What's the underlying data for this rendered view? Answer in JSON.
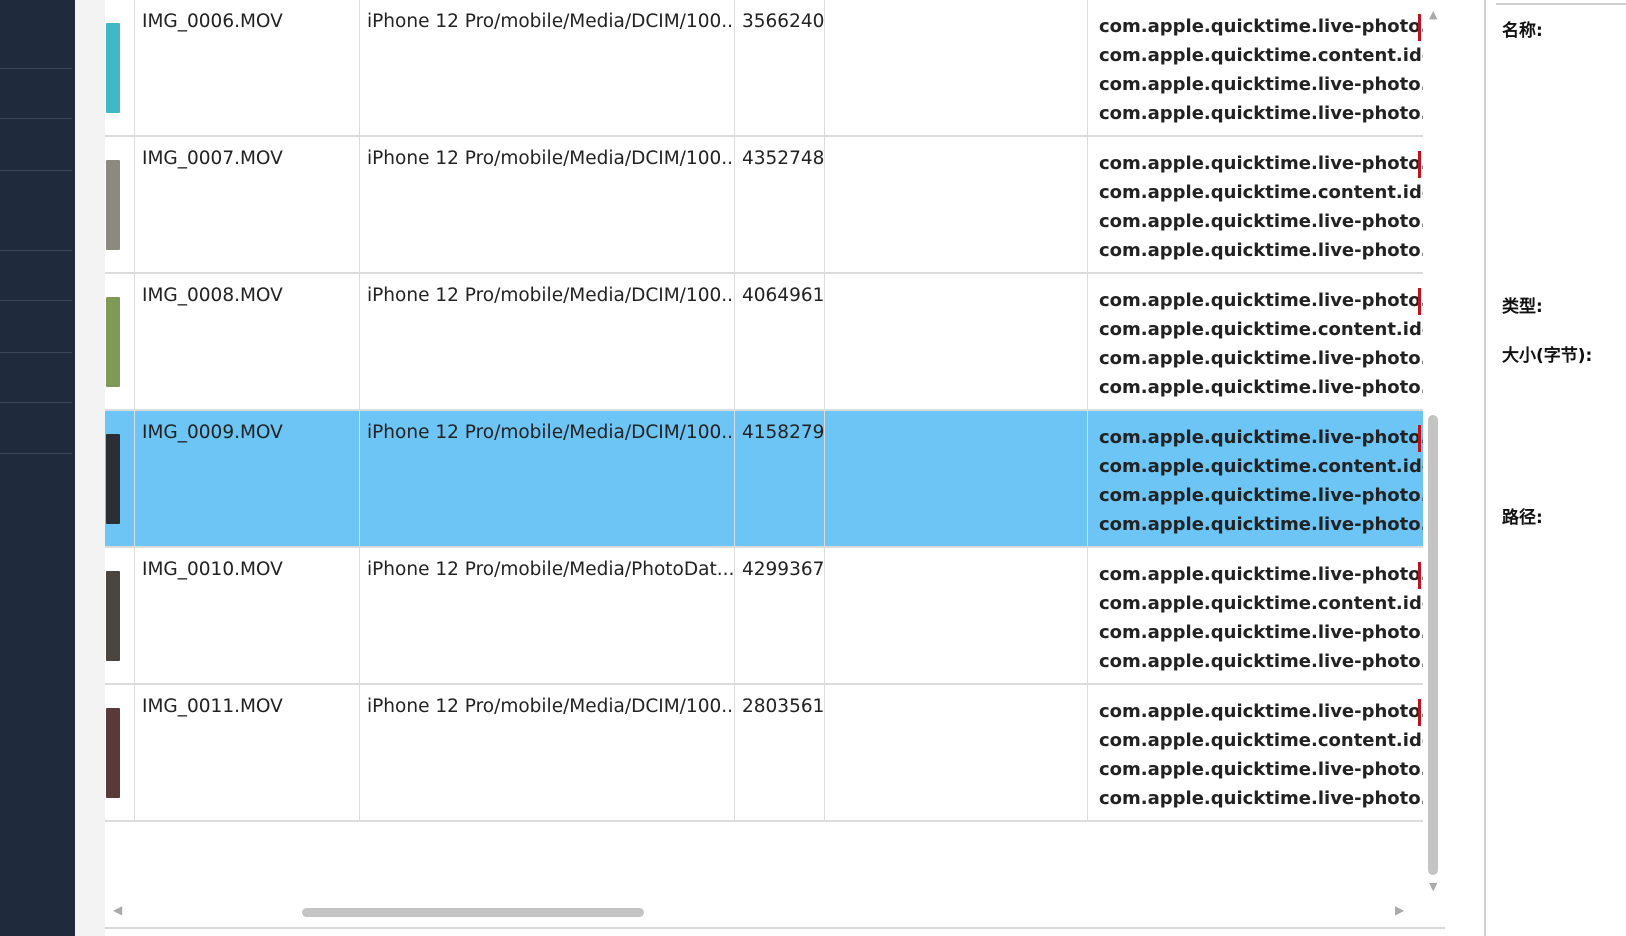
{
  "rows": [
    {
      "name": "IMG_0006.MOV",
      "path": "iPhone 12 Pro/mobile/Media/DCIM/100...",
      "size": "3566240",
      "thumb_color": "#3fb8c8",
      "meta": [
        "com.apple.quicktime.live-photo.aut",
        "com.apple.quicktime.content.identi",
        "com.apple.quicktime.live-photo.vita",
        "com.apple.quicktime.live-photo.vita"
      ]
    },
    {
      "name": "IMG_0007.MOV",
      "path": "iPhone 12 Pro/mobile/Media/DCIM/100...",
      "size": "4352748",
      "thumb_color": "#8a8a80",
      "meta": [
        "com.apple.quicktime.live-photo.aut",
        "com.apple.quicktime.content.identi",
        "com.apple.quicktime.live-photo.vita",
        "com.apple.quicktime.live-photo.vita"
      ]
    },
    {
      "name": "IMG_0008.MOV",
      "path": "iPhone 12 Pro/mobile/Media/DCIM/100...",
      "size": "4064961",
      "thumb_color": "#7f9a55",
      "meta": [
        "com.apple.quicktime.live-photo.aut",
        "com.apple.quicktime.content.identi",
        "com.apple.quicktime.live-photo.vita",
        "com.apple.quicktime.live-photo.vita"
      ]
    },
    {
      "name": "IMG_0009.MOV",
      "path": "iPhone 12 Pro/mobile/Media/DCIM/100...",
      "size": "4158279",
      "thumb_color": "#2b2f33",
      "meta": [
        "com.apple.quicktime.live-photo.aut",
        "com.apple.quicktime.content.identi",
        "com.apple.quicktime.live-photo.vita",
        "com.apple.quicktime.live-photo.vita"
      ]
    },
    {
      "name": "IMG_0010.MOV",
      "path": "iPhone 12 Pro/mobile/Media/PhotoDat...",
      "size": "4299367",
      "thumb_color": "#4a4540",
      "meta": [
        "com.apple.quicktime.live-photo.aut",
        "com.apple.quicktime.content.identi",
        "com.apple.quicktime.live-photo.vita",
        "com.apple.quicktime.live-photo.vita"
      ]
    },
    {
      "name": "IMG_0011.MOV",
      "path": "iPhone 12 Pro/mobile/Media/DCIM/100...",
      "size": "2803561",
      "thumb_color": "#5a3a38",
      "meta": [
        "com.apple.quicktime.live-photo.aut",
        "com.apple.quicktime.content.identi",
        "com.apple.quicktime.live-photo.vita",
        "com.apple.quicktime.live-photo.vita"
      ]
    }
  ],
  "selected_row": 3,
  "details": {
    "name_label": "名称:",
    "type_label": "类型:",
    "size_label": "大小(字节):",
    "path_label": "路径:"
  },
  "colors": {
    "selection": "#6cc5f5",
    "sidebar": "#1f2b3c",
    "marker": "#c0121b"
  }
}
